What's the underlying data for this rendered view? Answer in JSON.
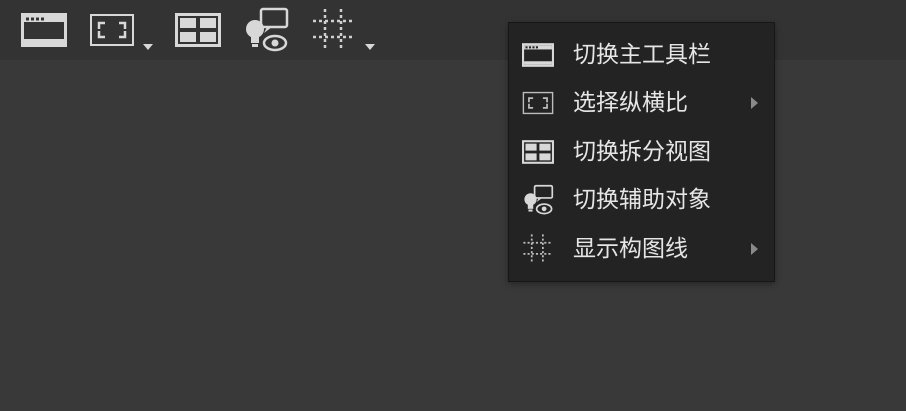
{
  "toolbar": {
    "buttons": [
      {
        "icon": "toolbar-window-icon",
        "has_dropdown": false
      },
      {
        "icon": "aspect-ratio-icon",
        "has_dropdown": true
      },
      {
        "icon": "split-view-icon",
        "has_dropdown": false
      },
      {
        "icon": "helpers-visibility-icon",
        "has_dropdown": false
      },
      {
        "icon": "composition-grid-icon",
        "has_dropdown": true
      }
    ]
  },
  "menu": {
    "items": [
      {
        "label": "切换主工具栏",
        "icon": "toolbar-window-icon",
        "has_submenu": false
      },
      {
        "label": "选择纵横比",
        "icon": "aspect-ratio-icon",
        "has_submenu": true
      },
      {
        "label": "切换拆分视图",
        "icon": "split-view-icon",
        "has_submenu": false
      },
      {
        "label": "切换辅助对象",
        "icon": "helpers-visibility-icon",
        "has_submenu": false
      },
      {
        "label": "显示构图线",
        "icon": "composition-grid-icon",
        "has_submenu": true
      }
    ]
  },
  "colors": {
    "toolbar_bg": "#333333",
    "viewport_bg": "#393939",
    "menu_bg": "#232323",
    "menu_text": "#e6e6e6",
    "icon": "#d8d8d8"
  }
}
